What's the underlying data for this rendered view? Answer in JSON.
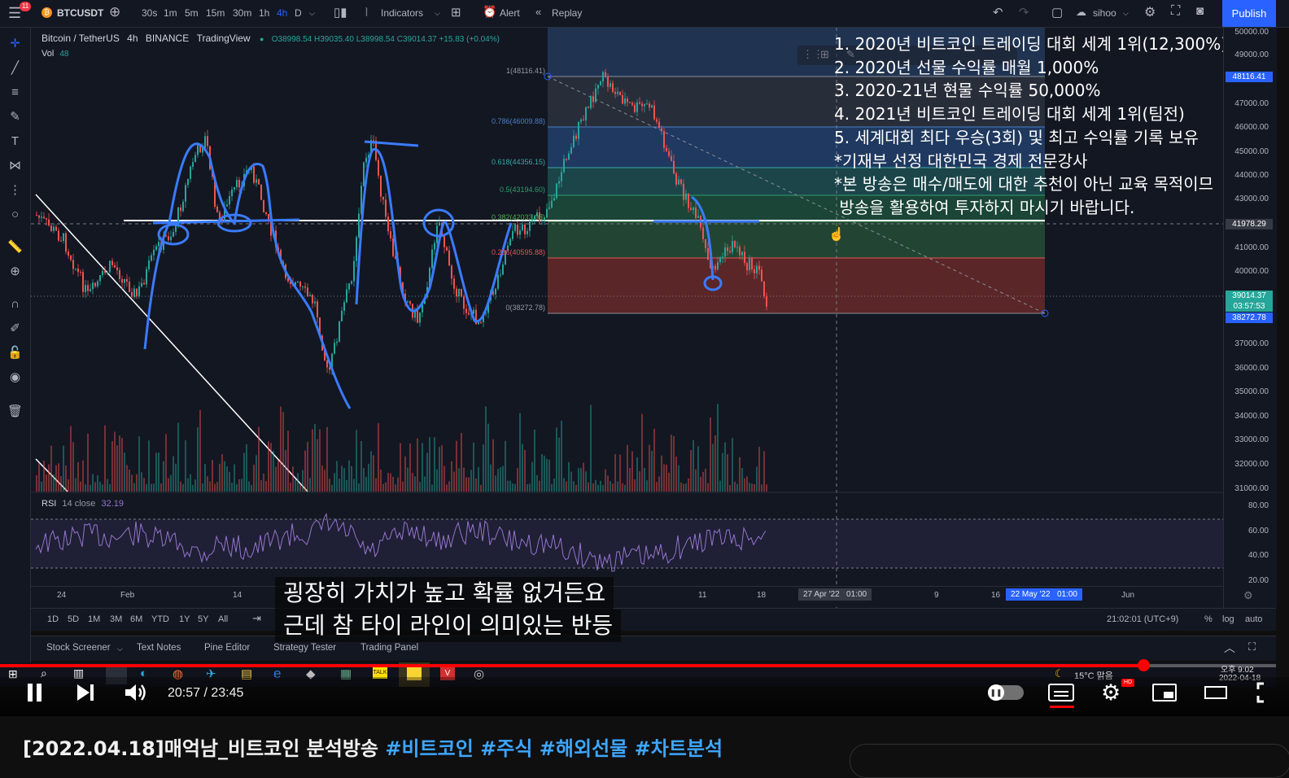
{
  "topbar": {
    "symbol": "BTCUSDT",
    "badge": "11",
    "intervals": [
      "30s",
      "1m",
      "5m",
      "15m",
      "30m",
      "1h",
      "4h",
      "D"
    ],
    "active_interval": "4h",
    "indicators": "Indicators",
    "alert": "Alert",
    "replay": "Replay",
    "layout_name": "sihoo",
    "publish": "Publish"
  },
  "legend": {
    "title": "Bitcoin / TetherUS",
    "interval": "4h",
    "exchange": "BINANCE",
    "source": "TradingView",
    "ohlc": "O38998.54 H39035.40 L38998.54 C39014.37 +15.83 (+0.04%)",
    "vol_label": "Vol",
    "vol_value": "48"
  },
  "fib_levels": [
    {
      "label": "1(48116.41)"
    },
    {
      "label": "0.786(46009.88)"
    },
    {
      "label": "0.618(44356.15)"
    },
    {
      "label": "0.5(43194.60)"
    },
    {
      "label": "0.382(42033.05)"
    },
    {
      "label": "0.236(40595.88)"
    },
    {
      "label": "0(38272.78)"
    }
  ],
  "price_ticks": [
    "50000.00",
    "49000.00",
    "47000.00",
    "46000.00",
    "45000.00",
    "44000.00",
    "43000.00",
    "41000.00",
    "40000.00",
    "37000.00",
    "36000.00",
    "35000.00",
    "34000.00",
    "33000.00",
    "32000.00",
    "31000.00"
  ],
  "price_labels": {
    "fib_top": "48116.41",
    "line": "41978.29",
    "current": "39014.37",
    "countdown": "03:57:53",
    "fib_bottom": "38272.78"
  },
  "rsi": {
    "label": "RSI",
    "params": "14 close",
    "value": "32.19",
    "ticks": [
      "80.00",
      "60.00",
      "40.00",
      "20.00"
    ]
  },
  "time_axis": [
    "24",
    "Feb",
    "14",
    "11",
    "18",
    "27 Apr '22   01:00",
    "9",
    "16",
    "22 May '22   01:00",
    "Jun"
  ],
  "overlay_lines": [
    "1. 2020년 비트코인 트레이딩 대회 세계 1위(12,300%)",
    "2. 2020년 선물 수익률 매월 1,000%",
    "3. 2020-21년 현물 수익률 50,000%",
    "4. 2021년 비트코인 트레이딩 대회 세계 1위(팀전)",
    "5. 세계대회 최다 우승(3회) 및 최고 수익률 기록 보유",
    "*기재부 선정 대한민국 경제 전문강사",
    "*본 방송은 매수/매도에 대한 추천이 아닌 교육 목적이므",
    " 방송을 활용하여 투자하지 마시기 바랍니다."
  ],
  "ranges": [
    "1D",
    "5D",
    "1M",
    "3M",
    "6M",
    "YTD",
    "1Y",
    "5Y",
    "All"
  ],
  "range_right": {
    "time": "21:02:01 (UTC+9)",
    "pct": "%",
    "log": "log",
    "auto": "auto"
  },
  "panels": [
    "Stock Screener",
    "Text Notes",
    "Pine Editor",
    "Strategy Tester",
    "Trading Panel"
  ],
  "subtitles": [
    "굉장히 가치가 높고 확률 없거든요",
    "근데 참 타이 라인이 의미있는 반등"
  ],
  "taskbar": {
    "weather": "15°C 맑음",
    "time": "오후 9:02",
    "date": "2022-04-18"
  },
  "player": {
    "time": "20:57 / 23:45",
    "progress": 0.897
  },
  "video": {
    "title_prefix": "[2022.04.18]매억남_비트코인 분석방송 ",
    "hashtags": [
      "#비트코인",
      "#주식",
      "#해외선물",
      "#차트분석"
    ]
  }
}
